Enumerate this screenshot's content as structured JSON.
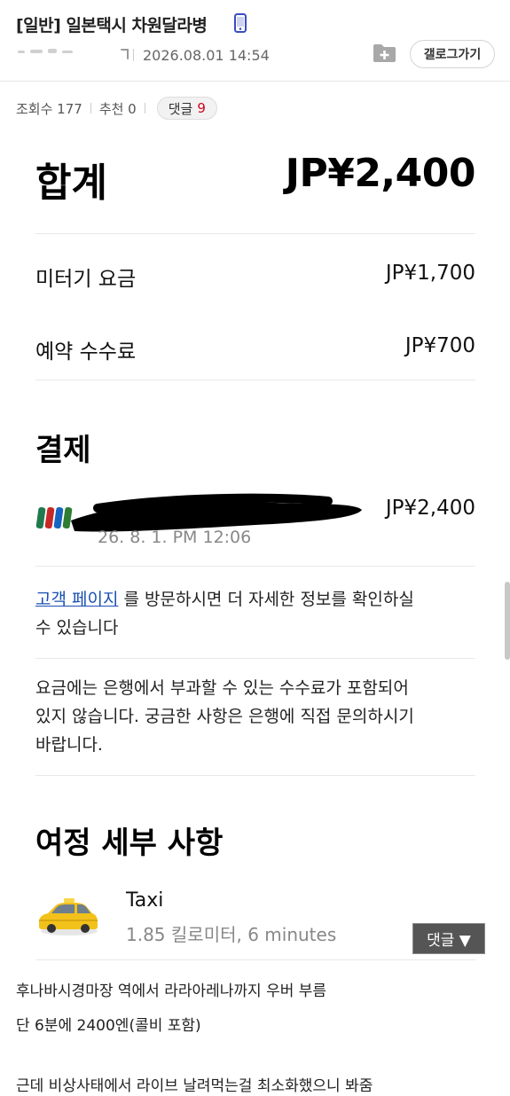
{
  "post": {
    "title": "[일반] 일본택시 차원달라병",
    "date": "2026.08.01 14:54",
    "back_label": "갤로그가기",
    "views": "조회수 177",
    "recommend": "추천 0",
    "comments_label": "댓글",
    "comments_count": "9"
  },
  "receipt": {
    "total_label": "합계",
    "total_value": "JP¥2,400",
    "lines": [
      {
        "label": "미터기 요금",
        "value": "JP¥1,700"
      },
      {
        "label": "예약 수수료",
        "value": "JP¥700"
      }
    ],
    "payment_heading": "결제",
    "payment_amount": "JP¥2,400",
    "payment_date": "26. 8. 1. PM 12:06",
    "info_link": "고객 페이지",
    "info_text_1": " 를 방문하시면 더 자세한 정보를 확인하실",
    "info_text_2": "수 있습니다",
    "fee_note_1": "요금에는 은행에서 부과할 수 있는 수수료가 포함되어",
    "fee_note_2": "있지 않습니다. 궁금한 사항은 은행에 직접 문의하시기",
    "fee_note_3": "바랍니다.",
    "trip_heading": "여정 세부 사항",
    "vehicle_name": "Taxi",
    "trip_detail": "1.85 킬로미터, 6 minutes"
  },
  "floating": {
    "comment_button": "댓글 ▼"
  },
  "body": {
    "line1": "후나바시경마장 역에서 라라아레나까지 우버 부름",
    "line2": "단 6분에 2400엔(콜비 포함)",
    "line3": "근데 비상사태에서 라이브 날려먹는걸 최소화했으니 봐줌"
  },
  "colors": {
    "link": "#1a4fb3",
    "comment_count": "#d0021b",
    "phone_icon": "#3b4cc0"
  },
  "icons": [
    "phone-icon",
    "folder-add-icon",
    "card-icon",
    "taxi-icon"
  ]
}
